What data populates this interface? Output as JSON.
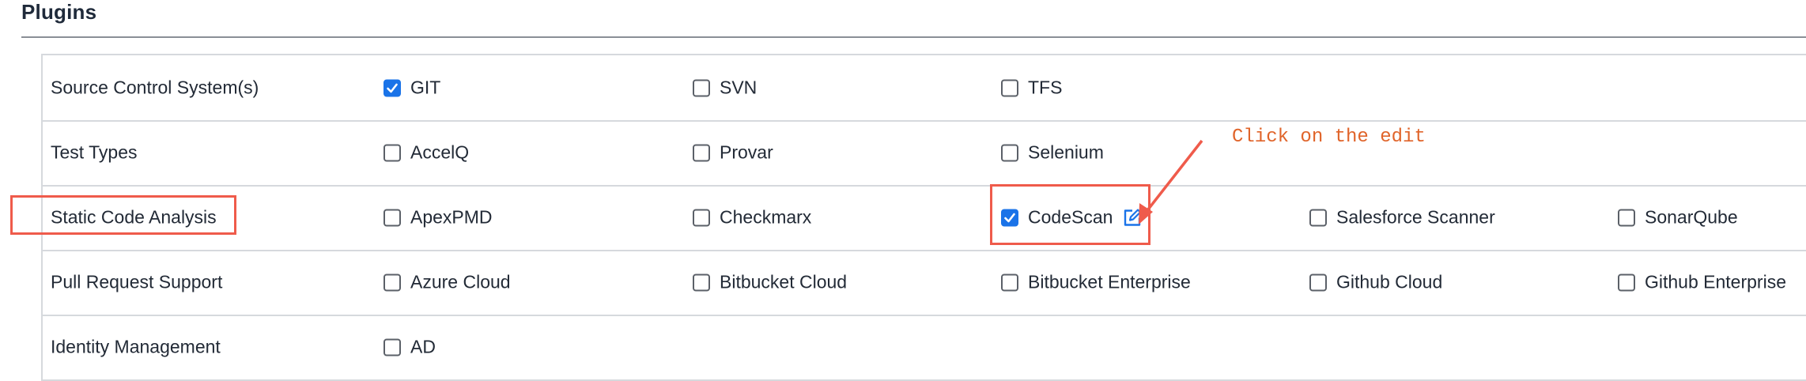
{
  "section": {
    "title": "Plugins"
  },
  "rows": [
    {
      "label": "Source Control System(s)",
      "options": [
        {
          "label": "GIT",
          "checked": true
        },
        {
          "label": "SVN",
          "checked": false
        },
        {
          "label": "TFS",
          "checked": false
        }
      ]
    },
    {
      "label": "Test Types",
      "options": [
        {
          "label": "AccelQ",
          "checked": false
        },
        {
          "label": "Provar",
          "checked": false
        },
        {
          "label": "Selenium",
          "checked": false
        }
      ]
    },
    {
      "label": "Static Code Analysis",
      "options": [
        {
          "label": "ApexPMD",
          "checked": false
        },
        {
          "label": "Checkmarx",
          "checked": false
        },
        {
          "label": "CodeScan",
          "checked": true,
          "icon": "edit-icon"
        },
        {
          "label": "Salesforce Scanner",
          "checked": false
        },
        {
          "label": "SonarQube",
          "checked": false
        }
      ]
    },
    {
      "label": "Pull Request Support",
      "options": [
        {
          "label": "Azure Cloud",
          "checked": false
        },
        {
          "label": "Bitbucket Cloud",
          "checked": false
        },
        {
          "label": "Bitbucket Enterprise",
          "checked": false
        },
        {
          "label": "Github Cloud",
          "checked": false
        },
        {
          "label": "Github Enterprise",
          "checked": false
        }
      ]
    },
    {
      "label": "Identity Management",
      "options": [
        {
          "label": "AD",
          "checked": false
        }
      ]
    }
  ],
  "annotation": {
    "text": "Click on the edit",
    "color": "#ef5b4b",
    "text_color": "#e0642a"
  },
  "colors": {
    "checkbox_checked": "#1a73e8",
    "edit_icon": "#1a73e8",
    "border": "#d6d9dd"
  }
}
